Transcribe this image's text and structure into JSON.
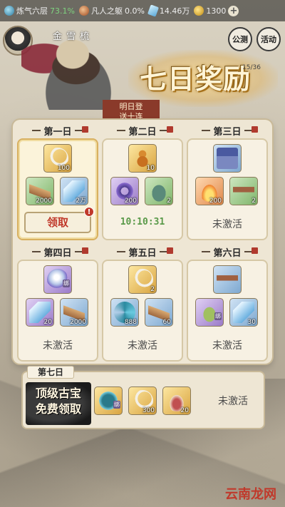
{
  "topbar": {
    "realm_label": "炼气六层",
    "realm_percent": "73.1%",
    "body_label": "凡人之躯",
    "body_percent": "0.0%",
    "spirit_stone": "14.46万",
    "coins": "1300",
    "plus_label": "+"
  },
  "header": {
    "hero_name": "金 雪 梳",
    "side_btn_1": "公测",
    "side_btn_2": "活动",
    "title": "七日奖励",
    "progress": "15/36",
    "promo_line1": "明日登",
    "promo_line2": "送十连"
  },
  "days": [
    {
      "label": "第一日",
      "items": [
        {
          "icon": "hook-treasure-icon",
          "qty": "100"
        },
        {
          "icon": "scroll-icon",
          "qty": "2000"
        },
        {
          "icon": "crystal-icon",
          "qty": "2万"
        }
      ],
      "action": "领取",
      "alert": "!"
    },
    {
      "label": "第二日",
      "items": [
        {
          "icon": "gourd-icon",
          "qty": "10"
        },
        {
          "icon": "ring-icon",
          "qty": "200"
        },
        {
          "icon": "cauldron-icon",
          "qty": "2"
        }
      ],
      "timer": "10:10:31"
    },
    {
      "label": "第三日",
      "items": [
        {
          "icon": "chest-icon",
          "qty": ""
        },
        {
          "icon": "flame-icon",
          "qty": "200"
        },
        {
          "icon": "table-icon",
          "qty": "2"
        }
      ],
      "status": "未激活"
    },
    {
      "label": "第四日",
      "items": [
        {
          "icon": "spirit-orb-icon",
          "qty": "",
          "bind": "绑"
        },
        {
          "icon": "crystal-icon",
          "qty": "20"
        },
        {
          "icon": "cloth-icon",
          "qty": "2000"
        }
      ],
      "status": "未激活"
    },
    {
      "label": "第五日",
      "items": [
        {
          "icon": "hook-treasure-icon",
          "qty": "2"
        },
        {
          "icon": "swirl-icon",
          "qty": "888"
        },
        {
          "icon": "scroll-icon",
          "qty": "60"
        }
      ],
      "status": "未激活"
    },
    {
      "label": "第六日",
      "items": [
        {
          "icon": "chest-icon",
          "qty": ""
        },
        {
          "icon": "bell-icon",
          "qty": "",
          "bind": "绑"
        },
        {
          "icon": "sword-icon",
          "qty": "30"
        }
      ],
      "status": "未激活"
    }
  ],
  "day7": {
    "label": "第七日",
    "banner_line1": "顶级古宝",
    "banner_line2": "免费领取",
    "items": [
      {
        "icon": "jade-icon",
        "qty": "",
        "bind": "绑"
      },
      {
        "icon": "hook-treasure-icon",
        "qty": "300"
      },
      {
        "icon": "bottle-icon",
        "qty": "20"
      }
    ],
    "status": "未激活"
  },
  "watermark": "云南龙网"
}
